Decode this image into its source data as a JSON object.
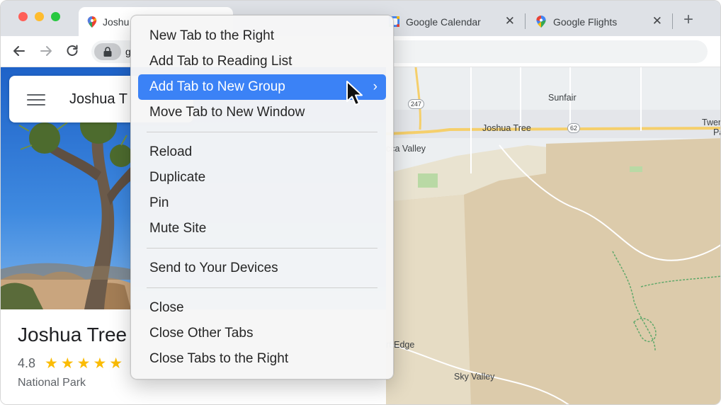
{
  "browser": {
    "tabs": [
      {
        "title": "Joshua Tree",
        "visible_title": "Joshu",
        "icon": "google-maps-icon",
        "active": true
      },
      {
        "title": "Google Calendar",
        "icon": "google-calendar-icon",
        "active": false
      },
      {
        "title": "Google Flights",
        "icon": "google-flights-icon",
        "active": false
      }
    ],
    "close_glyph": "✕",
    "new_tab_glyph": "+",
    "url_visible": "g"
  },
  "maps": {
    "search_text": "Joshua T",
    "place": {
      "title": "Joshua Tree",
      "rating": "4.8",
      "stars": "★★★★★",
      "type": "National Park"
    },
    "labels": {
      "sunfair": "Sunfair",
      "joshua_tree": "Joshua Tree",
      "yucca_valley": "cca Valley",
      "twentynine": "Twen",
      "twentynine_b": "Pa",
      "flamingo": "rt Edge",
      "sky_valley": "Sky Valley",
      "hwy_247": "247",
      "hwy_62": "62"
    }
  },
  "context_menu": {
    "groups": [
      [
        {
          "label": "New Tab to the Right"
        },
        {
          "label": "Add Tab to Reading List"
        },
        {
          "label": "Add Tab to New Group",
          "highlighted": true,
          "submenu": "›"
        },
        {
          "label": "Move Tab to New Window"
        }
      ],
      [
        {
          "label": "Reload"
        },
        {
          "label": "Duplicate"
        },
        {
          "label": "Pin"
        },
        {
          "label": "Mute Site"
        }
      ],
      [
        {
          "label": "Send to Your Devices"
        }
      ],
      [
        {
          "label": "Close"
        },
        {
          "label": "Close Other Tabs"
        },
        {
          "label": "Close Tabs to the Right"
        }
      ]
    ]
  },
  "colors": {
    "highlight": "#3b82f6",
    "star": "#fbbc04",
    "tabstrip": "#dee1e6",
    "map_base": "#e8e1cf"
  }
}
